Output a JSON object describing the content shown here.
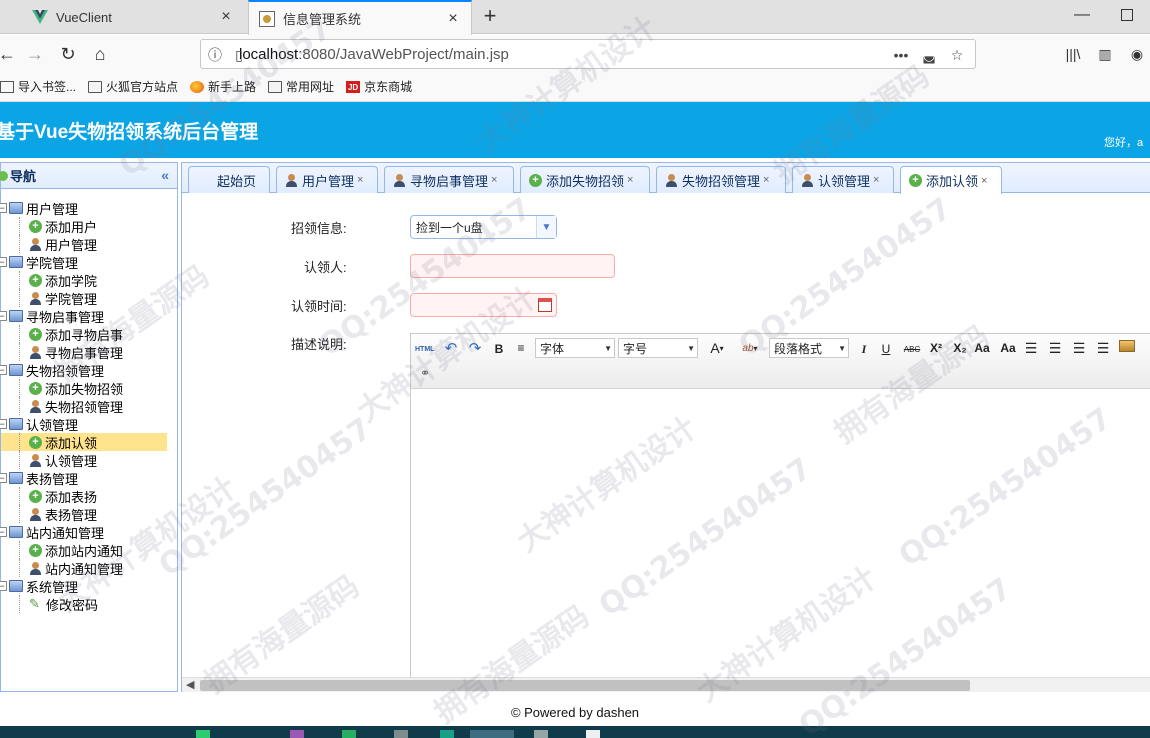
{
  "browser": {
    "tabs": [
      {
        "title": "VueClient",
        "active": false
      },
      {
        "title": "信息管理系统",
        "active": true
      }
    ],
    "url_host": "localhost",
    "url_rest": ":8080/JavaWebProject/main.jsp",
    "bookmarks": [
      "导入书签...",
      "火狐官方站点",
      "新手上路",
      "常用网址",
      "京东商城"
    ]
  },
  "app": {
    "title": "基于Vue失物招领系统后台管理",
    "greeting": "您好，a"
  },
  "sidebar": {
    "title": "导航",
    "groups": [
      {
        "label": "用户管理",
        "children": [
          "添加用户",
          "用户管理"
        ]
      },
      {
        "label": "学院管理",
        "children": [
          "添加学院",
          "学院管理"
        ]
      },
      {
        "label": "寻物启事管理",
        "children": [
          "添加寻物启事",
          "寻物启事管理"
        ]
      },
      {
        "label": "失物招领管理",
        "children": [
          "添加失物招领",
          "失物招领管理"
        ]
      },
      {
        "label": "认领管理",
        "children": [
          "添加认领",
          "认领管理"
        ]
      },
      {
        "label": "表扬管理",
        "children": [
          "添加表扬",
          "表扬管理"
        ]
      },
      {
        "label": "站内通知管理",
        "children": [
          "添加站内通知",
          "站内通知管理"
        ]
      },
      {
        "label": "系统管理",
        "children": [
          "修改密码"
        ]
      }
    ],
    "selected": "添加认领"
  },
  "tabs": [
    {
      "label": "起始页",
      "closable": false
    },
    {
      "label": "用户管理",
      "closable": true
    },
    {
      "label": "寻物启事管理",
      "closable": true
    },
    {
      "label": "添加失物招领",
      "closable": true
    },
    {
      "label": "失物招领管理",
      "closable": true
    },
    {
      "label": "认领管理",
      "closable": true
    },
    {
      "label": "添加认领",
      "closable": true,
      "active": true
    }
  ],
  "form": {
    "claim_info_label": "招领信息:",
    "claim_info_value": "捡到一个u盘",
    "claimant_label": "认领人:",
    "claimant_value": "",
    "claim_time_label": "认领时间:",
    "claim_time_value": "",
    "description_label": "描述说明:"
  },
  "editor": {
    "html_label": "HTML",
    "bold": "B",
    "italic": "I",
    "underline": "U",
    "strike": "ABC",
    "font_family": "字体",
    "font_size": "字号",
    "paragraph": "段落格式",
    "font_color": "A",
    "highlight": "ab"
  },
  "footer": "© Powered by dashen",
  "watermarks": [
    "QQ:254540457",
    "大神计算机设计",
    "拥有海量源码"
  ],
  "colors": {
    "header": "#0ba5e6",
    "accent_border": "#95b8e7",
    "selected_row": "#ffe48d",
    "invalid_bg": "#fff3f3"
  }
}
